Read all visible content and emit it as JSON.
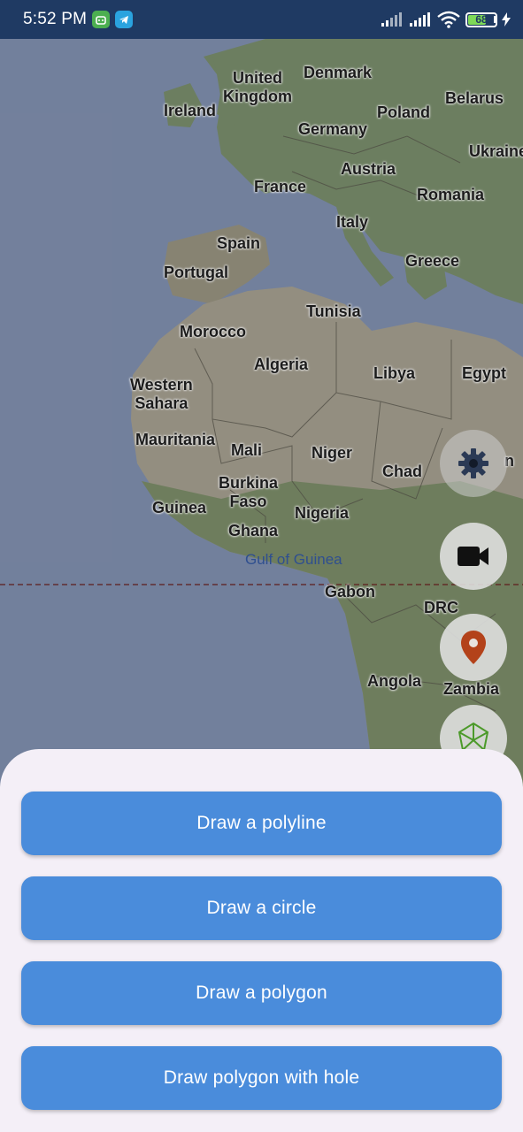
{
  "status_bar": {
    "time": "5:52 PM",
    "battery_level": "68",
    "icons": [
      "robot-icon",
      "telegram-icon",
      "signal-icon",
      "signal-icon",
      "wifi-icon",
      "battery-icon",
      "charging-icon"
    ]
  },
  "map": {
    "labels": {
      "ireland": "Ireland",
      "united_kingdom": "United\nKingdom",
      "denmark": "Denmark",
      "belarus": "Belarus",
      "poland": "Poland",
      "germany": "Germany",
      "ukraine": "Ukraine",
      "austria": "Austria",
      "france": "France",
      "romania": "Romania",
      "italy": "Italy",
      "spain": "Spain",
      "portugal": "Portugal",
      "greece": "Greece",
      "tunisia": "Tunisia",
      "morocco": "Morocco",
      "algeria": "Algeria",
      "libya": "Libya",
      "egypt": "Egypt",
      "western_sahara": "Western\nSahara",
      "mauritania": "Mauritania",
      "mali": "Mali",
      "niger": "Niger",
      "chad": "Chad",
      "sudan_partial": "n",
      "burkina_faso": "Burkina\nFaso",
      "guinea": "Guinea",
      "nigeria": "Nigeria",
      "ghana": "Ghana",
      "gulf_of_guinea": "Gulf of Guinea",
      "gabon": "Gabon",
      "drc": "DRC",
      "angola": "Angola",
      "zambia": "Zambia"
    }
  },
  "fabs": {
    "settings": "gear-icon",
    "camera": "video-camera-icon",
    "location": "location-pin-icon",
    "shapes": "polygon-shape-icon"
  },
  "sheet": {
    "buttons": [
      {
        "label": "Draw a polyline"
      },
      {
        "label": "Draw a circle"
      },
      {
        "label": "Draw a polygon"
      },
      {
        "label": "Draw polygon with hole"
      }
    ]
  },
  "colors": {
    "button": "#4a8cdb",
    "sheet": "#f4eff7",
    "status_bar": "#1f3a63",
    "pin": "#b3421a"
  }
}
